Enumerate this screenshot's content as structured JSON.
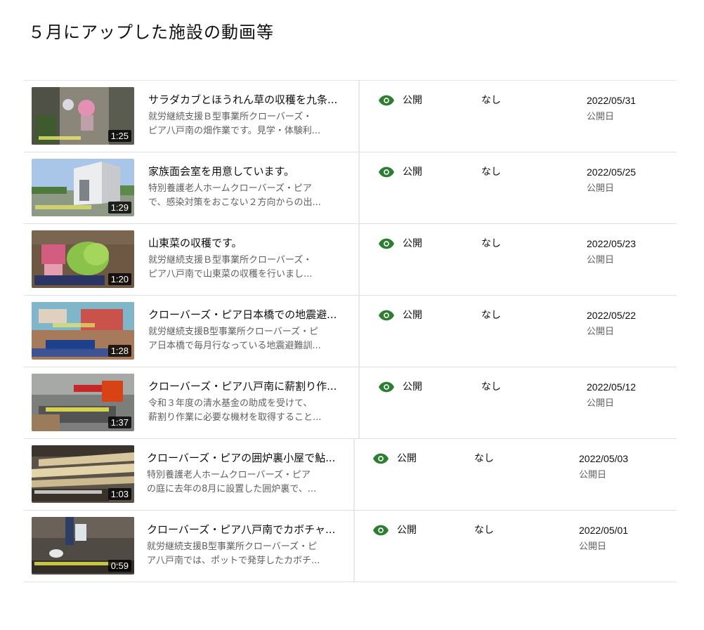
{
  "page": {
    "title": "５月にアップした施設の動画等"
  },
  "colors": {
    "visibility_icon": "#2e7d32",
    "text_primary": "#0f0f0f",
    "text_secondary": "#606060"
  },
  "videos": [
    {
      "title": "サラダカブとほうれん草の収穫を九条...",
      "desc_line1": "就労継続支援Ｂ型事業所クローバーズ・",
      "desc_line2": "ピア八戸南の畑作業です。見学・体験利...",
      "duration": "1:25",
      "visibility": "公開",
      "visibility_icon": "eye-icon",
      "restriction": "なし",
      "date": "2022/05/31",
      "date_label": "公開日"
    },
    {
      "title": "家族面会室を用意しています。",
      "desc_line1": "特別養護老人ホームクローバーズ・ピア",
      "desc_line2": "で、感染対策をおこない２方向からの出...",
      "duration": "1:29",
      "visibility": "公開",
      "visibility_icon": "eye-icon",
      "restriction": "なし",
      "date": "2022/05/25",
      "date_label": "公開日"
    },
    {
      "title": "山東菜の収穫です。",
      "desc_line1": "就労継続支援Ｂ型事業所クローバーズ・",
      "desc_line2": "ピア八戸南で山東菜の収穫を行いまし...",
      "duration": "1:20",
      "visibility": "公開",
      "visibility_icon": "eye-icon",
      "restriction": "なし",
      "date": "2022/05/23",
      "date_label": "公開日"
    },
    {
      "title": "クローバーズ・ピア日本橋での地震避...",
      "desc_line1": "就労継続支援B型事業所クローバーズ・ピ",
      "desc_line2": "ア日本橋で毎月行なっている地震避難訓...",
      "duration": "1:28",
      "visibility": "公開",
      "visibility_icon": "eye-icon",
      "restriction": "なし",
      "date": "2022/05/22",
      "date_label": "公開日"
    },
    {
      "title": "クローバーズ・ピア八戸南に薪割り作...",
      "desc_line1": "令和３年度の清水基金の助成を受けて、",
      "desc_line2": "薪割り作業に必要な機材を取得すること...",
      "duration": "1:37",
      "visibility": "公開",
      "visibility_icon": "eye-icon",
      "restriction": "なし",
      "date": "2022/05/12",
      "date_label": "公開日"
    },
    {
      "title": "クローバーズ・ピアの囲炉裏小屋で鮎...",
      "desc_line1": "特別養護老人ホームクローバーズ・ピア",
      "desc_line2": "の庭に去年の8月に設置した囲炉裏で、...",
      "duration": "1:03",
      "visibility": "公開",
      "visibility_icon": "eye-icon",
      "restriction": "なし",
      "date": "2022/05/03",
      "date_label": "公開日"
    },
    {
      "title": "クローバーズ・ピア八戸南でカボチャ...",
      "desc_line1": "就労継続支援B型事業所クローバーズ・ピ",
      "desc_line2": "ア八戸南では、ポットで発芽したカボチ...",
      "duration": "0:59",
      "visibility": "公開",
      "visibility_icon": "eye-icon",
      "restriction": "なし",
      "date": "2022/05/01",
      "date_label": "公開日"
    }
  ]
}
